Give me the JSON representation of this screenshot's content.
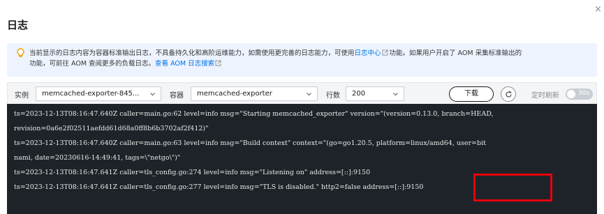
{
  "dialog": {
    "title": "日志",
    "close_glyph": "×"
  },
  "notice": {
    "icon": "lightbulb-icon",
    "text_part1": "当前显示的日志内容为容器标准输出日志，不具备持久化和高阶运维能力，如需使用更完善的日志能力，可使用",
    "link1": "日志中心",
    "text_part2": "功能。如果用户开启了 AOM 采集标准输出的",
    "text_part3": "功能，可前往 AOM 查阅更多的负载日志。",
    "link2": "查看 AOM 日志搜索"
  },
  "toolbar": {
    "instance_label": "实例",
    "instance_value": "memcached-exporter-845...",
    "container_label": "容器",
    "container_value": "memcached-exporter",
    "lines_label": "行数",
    "lines_value": "200",
    "download_label": "下载",
    "refresh_icon": "refresh-icon",
    "auto_refresh_label": "定时刷新",
    "auto_refresh_toggle_text": "30s",
    "auto_refresh_enabled": false
  },
  "logs": [
    "ts=2023-12-13T08:16:47.640Z caller=main.go:62 level=info msg=\"Starting memcached_exporter\" version=\"(version=0.13.0, branch=HEAD,",
    "revision=0a6e2f02511aefdd61d68a0ff8b6b3702af2f412)\"",
    "ts=2023-12-13T08:16:47.640Z caller=main.go:63 level=info msg=\"Build context\" context=\"(go=go1.20.5, platform=linux/amd64, user=bit",
    "nami, date=20230616-14:49:41, tags=\\\"netgo\\\")\"",
    "ts=2023-12-13T08:16:47.641Z caller=tls_config.go:274 level=info msg=\"Listening on\" address=[::]:9150",
    "ts=2023-12-13T08:16:47.641Z caller=tls_config.go:277 level=info msg=\"TLS is disabled.\" http2=false address=[::]:9150"
  ],
  "colors": {
    "notice_bg": "#eef4ff",
    "link": "#0073e6",
    "log_bg": "#1e2329",
    "highlight": "#e8000b"
  }
}
